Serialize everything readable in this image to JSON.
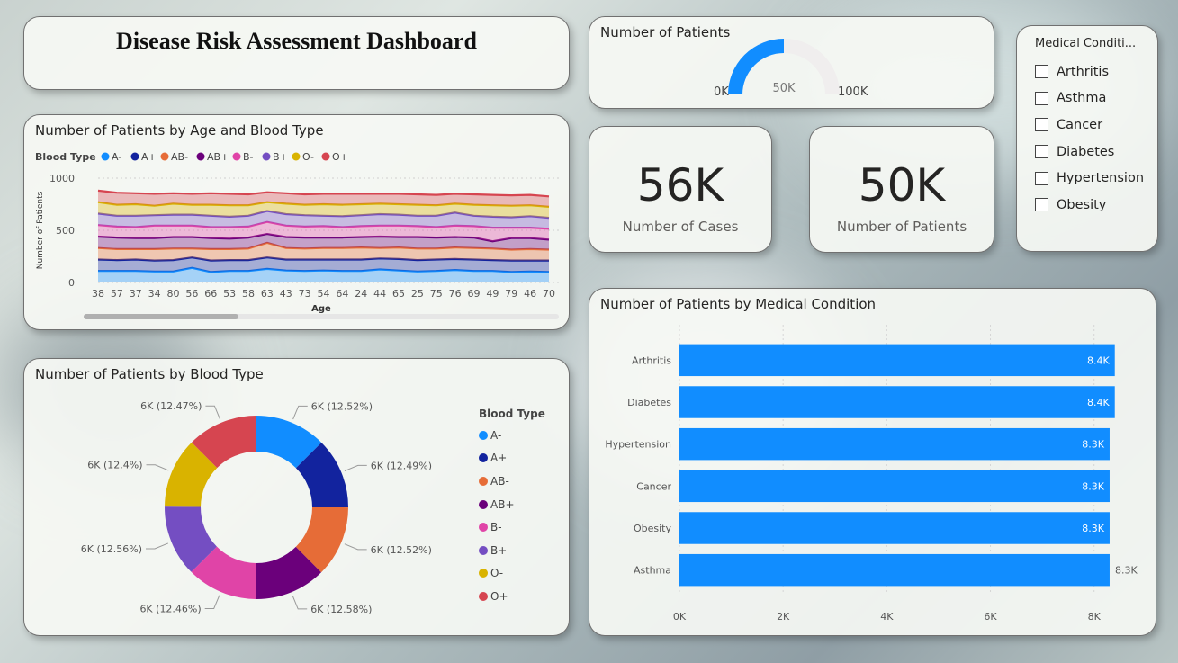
{
  "title": "Disease Risk Assessment Dashboard",
  "colors": {
    "A-": "#118DFF",
    "A+": "#12239E",
    "AB-": "#E66C37",
    "AB+": "#6B007B",
    "B-": "#E044A7",
    "B+": "#744EC2",
    "O-": "#D9B300",
    "O+": "#D64550",
    "bar": "#118DFF",
    "gauge_track": "#F0EEEE"
  },
  "gauge": {
    "title": "Number of Patients",
    "min_label": "0K",
    "max_label": "100K",
    "value_label": "50K",
    "value": 50,
    "max": 100
  },
  "kpis": [
    {
      "value": "56K",
      "label": "Number of Cases"
    },
    {
      "value": "50K",
      "label": "Number of Patients"
    }
  ],
  "slicer": {
    "title": "Medical Conditi...",
    "items": [
      "Arthritis",
      "Asthma",
      "Cancer",
      "Diabetes",
      "Hypertension",
      "Obesity"
    ]
  },
  "chart_data": [
    {
      "type": "area",
      "title": "Number of Patients by Age and Blood Type",
      "legend_title": "Blood Type",
      "xlabel": "Age",
      "ylabel": "Number of Patients",
      "ylim": [
        0,
        1000
      ],
      "y_ticks": [
        "0",
        "500",
        "1000"
      ],
      "stacked": true,
      "categories": [
        "38",
        "57",
        "37",
        "34",
        "80",
        "56",
        "66",
        "53",
        "58",
        "63",
        "43",
        "73",
        "54",
        "64",
        "24",
        "44",
        "65",
        "25",
        "75",
        "76",
        "69",
        "49",
        "79",
        "46",
        "70"
      ],
      "series": [
        {
          "name": "A-",
          "values": [
            110,
            110,
            110,
            105,
            105,
            140,
            100,
            110,
            110,
            130,
            115,
            110,
            115,
            110,
            110,
            125,
            115,
            105,
            110,
            120,
            110,
            110,
            100,
            105,
            100
          ]
        },
        {
          "name": "A+",
          "values": [
            110,
            105,
            110,
            105,
            110,
            100,
            110,
            105,
            105,
            110,
            105,
            110,
            105,
            110,
            110,
            105,
            110,
            110,
            110,
            105,
            110,
            105,
            110,
            105,
            110
          ]
        },
        {
          "name": "AB-",
          "values": [
            110,
            105,
            100,
            110,
            110,
            85,
            110,
            105,
            110,
            140,
            110,
            105,
            110,
            110,
            115,
            100,
            110,
            110,
            105,
            110,
            110,
            110,
            105,
            110,
            105
          ]
        },
        {
          "name": "AB+",
          "values": [
            110,
            110,
            105,
            105,
            110,
            110,
            105,
            100,
            105,
            85,
            105,
            105,
            100,
            100,
            100,
            110,
            100,
            110,
            105,
            100,
            100,
            70,
            110,
            105,
            95
          ]
        },
        {
          "name": "B-",
          "values": [
            110,
            105,
            105,
            120,
            110,
            110,
            105,
            110,
            105,
            115,
            110,
            105,
            110,
            100,
            105,
            105,
            110,
            105,
            100,
            110,
            110,
            130,
            100,
            100,
            105
          ]
        },
        {
          "name": "B+",
          "values": [
            110,
            105,
            110,
            100,
            105,
            105,
            110,
            100,
            105,
            105,
            110,
            110,
            100,
            105,
            105,
            110,
            105,
            100,
            110,
            125,
            100,
            105,
            100,
            110,
            105
          ]
        },
        {
          "name": "O-",
          "values": [
            110,
            105,
            110,
            90,
            105,
            95,
            105,
            110,
            100,
            85,
            100,
            100,
            110,
            110,
            105,
            100,
            100,
            105,
            100,
            85,
            105,
            110,
            110,
            105,
            105
          ]
        },
        {
          "name": "O+",
          "values": [
            110,
            115,
            105,
            115,
            100,
            105,
            110,
            110,
            105,
            95,
            100,
            100,
            100,
            105,
            100,
            95,
            100,
            100,
            100,
            95,
            100,
            100,
            100,
            100,
            100
          ]
        }
      ]
    },
    {
      "type": "pie",
      "title": "Number of Patients by Blood Type",
      "legend_title": "Blood Type",
      "categories": [
        "A-",
        "A+",
        "AB-",
        "AB+",
        "B-",
        "B+",
        "O-",
        "O+"
      ],
      "values": [
        12.52,
        12.49,
        12.52,
        12.58,
        12.46,
        12.56,
        12.4,
        12.47
      ],
      "labels": [
        "6K (12.52%)",
        "6K (12.49%)",
        "6K (12.52%)",
        "6K (12.58%)",
        "6K (12.46%)",
        "6K (12.56%)",
        "6K (12.4%)",
        "6K (12.47%)"
      ]
    },
    {
      "type": "bar",
      "orientation": "horizontal",
      "title": "Number of Patients by Medical Condition",
      "categories": [
        "Arthritis",
        "Diabetes",
        "Hypertension",
        "Cancer",
        "Obesity",
        "Asthma"
      ],
      "values": [
        8.4,
        8.4,
        8.3,
        8.3,
        8.3,
        8.3
      ],
      "labels": [
        "8.4K",
        "8.4K",
        "8.3K",
        "8.3K",
        "8.3K",
        "8.3K"
      ],
      "x_ticks": [
        "0K",
        "2K",
        "4K",
        "6K",
        "8K"
      ],
      "xlim": [
        0,
        8.7
      ]
    }
  ]
}
